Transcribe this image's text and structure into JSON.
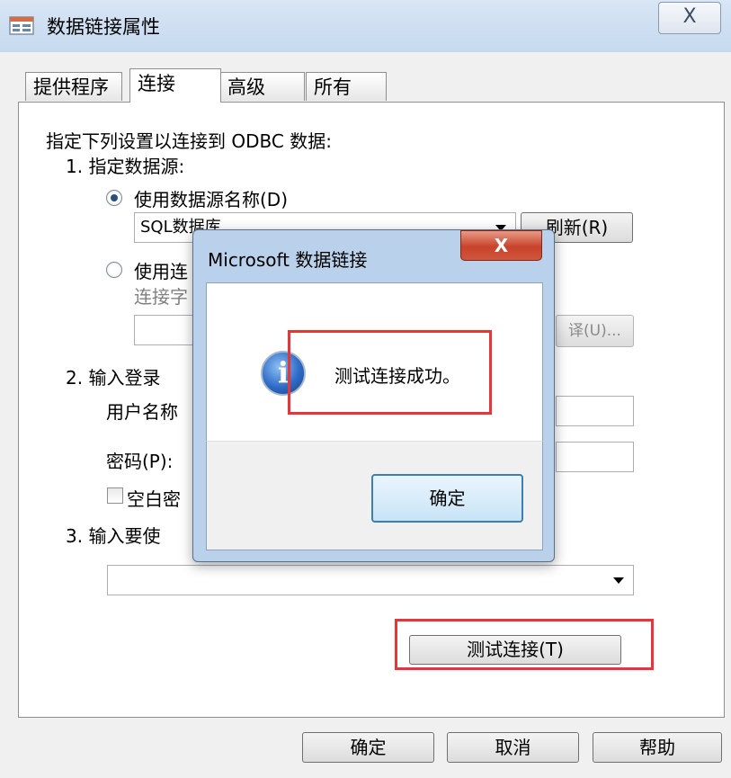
{
  "window": {
    "title": "数据链接属性",
    "close_label": "X"
  },
  "tabs": [
    {
      "label": "提供程序",
      "active": false
    },
    {
      "label": "连接",
      "active": true
    },
    {
      "label": "高级",
      "active": false
    },
    {
      "label": "所有",
      "active": false
    }
  ],
  "connection": {
    "intro": "指定下列设置以连接到 ODBC 数据:",
    "step1_label": "1. 指定数据源:",
    "radio_dsn_label": "使用数据源名称(D)",
    "dsn_value": "SQL数据库",
    "refresh_label": "刷新(R)",
    "radio_connstr_label": "使用连",
    "connstr_label": "连接字",
    "compile_label": "译(U)...",
    "step2_label": "2. 输入登录",
    "username_label": "用户名称",
    "password_label": "密码(P):",
    "blank_password_label": "空白密",
    "step3_label": "3. 输入要使",
    "test_button_label": "测试连接(T)"
  },
  "footer": {
    "ok_label": "确定",
    "cancel_label": "取消",
    "help_label": "帮助"
  },
  "messagebox": {
    "title": "Microsoft 数据链接",
    "close_label": "X",
    "message": "测试连接成功。",
    "ok_label": "确定",
    "icon": "info-icon"
  },
  "colors": {
    "highlight": "#e8353a",
    "titlebar": "#c6d9ef",
    "messagebox_frame": "#b9d1ea"
  }
}
